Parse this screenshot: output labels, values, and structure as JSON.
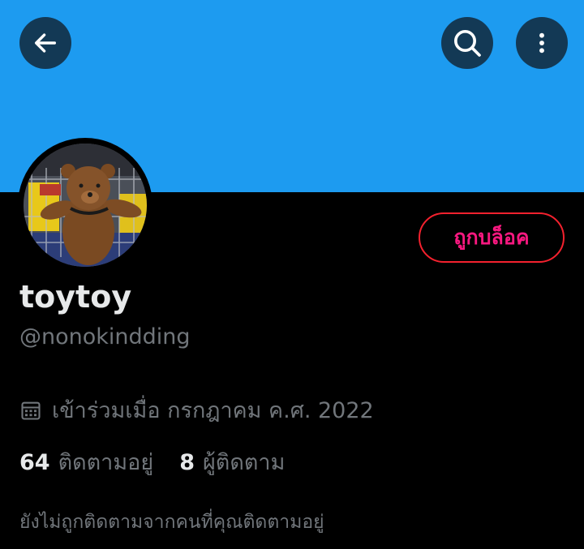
{
  "header": {
    "back_icon": "arrow-left-icon",
    "search_icon": "search-icon",
    "more_icon": "more-vertical-icon",
    "banner_color": "#1d9bf0"
  },
  "profile": {
    "display_name": "toytoy",
    "handle": "@nonokindding",
    "avatar_description": "teddy-bear-photo",
    "blocked_label": "ถูกบล็อค",
    "joined_icon": "calendar-icon",
    "joined_text": "เข้าร่วมเมื่อ กรกฎาคม ค.ศ. 2022",
    "following_count": "64",
    "following_label": "ติดตามอยู่",
    "followers_count": "8",
    "followers_label": "ผู้ติดตาม",
    "not_followed_text": "ยังไม่ถูกติดตามจากคนที่คุณติดตามอยู่"
  },
  "colors": {
    "blocked_border": "#f4212e",
    "blocked_text": "#f91880",
    "secondary_text": "#71767b",
    "primary_text": "#e7e9ea"
  }
}
